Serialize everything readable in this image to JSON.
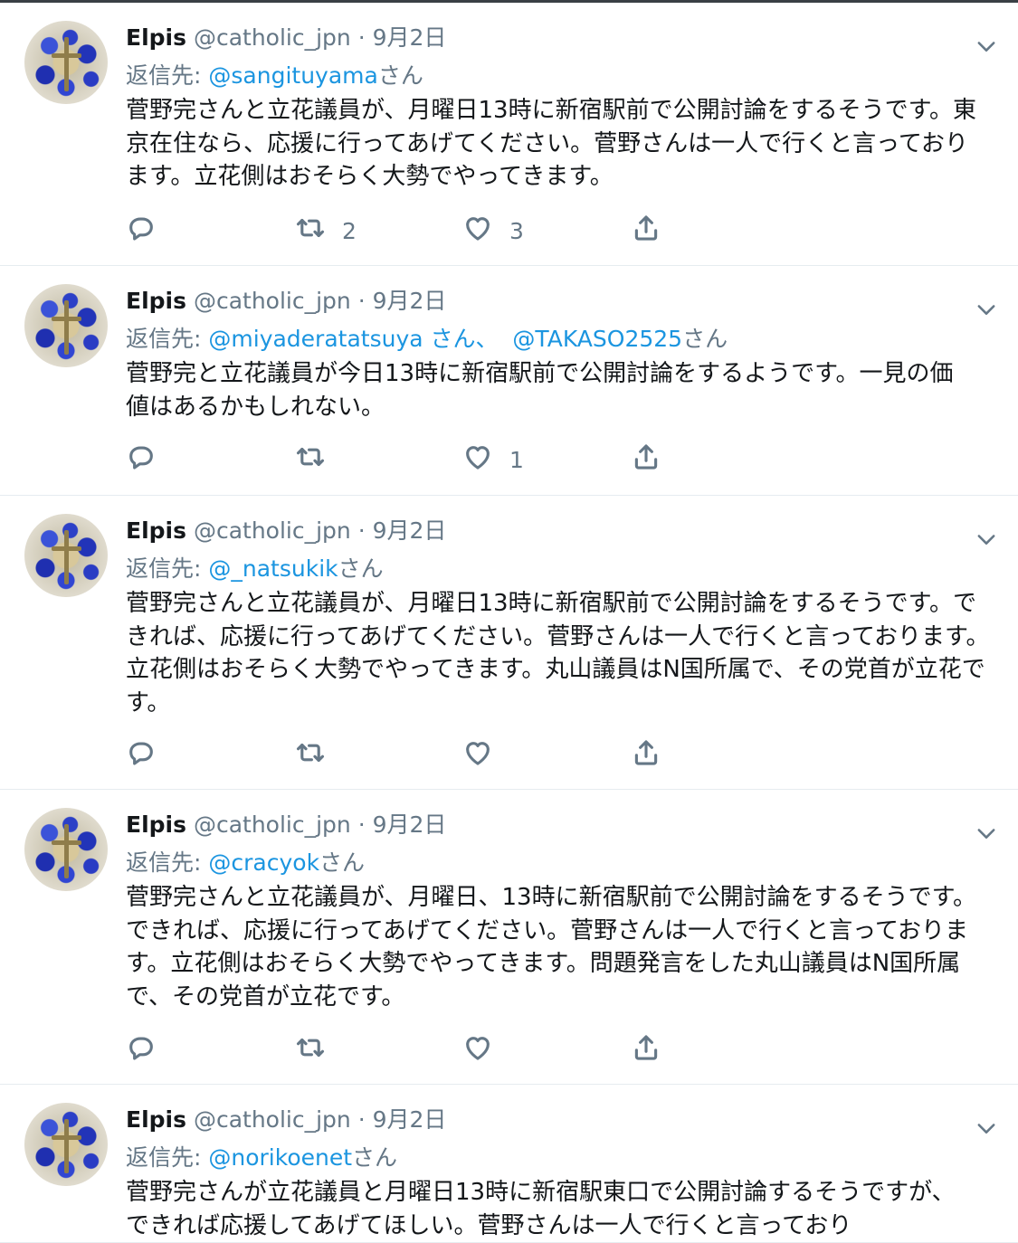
{
  "tweets": [
    {
      "name": "Elpis",
      "handle": "@catholic_jpn",
      "separator": "·",
      "date": "9月2日",
      "reply_label": "返信先:",
      "reply_to": [
        {
          "mention": "@sangituyama",
          "suffix": "さん"
        }
      ],
      "text": "菅野完さんと立花議員が、月曜日13時に新宿駅前で公開討論をするそうです。東京在住なら、応援に行ってあげてください。菅野さんは一人で行くと言っております。立花側はおそらく大勢でやってきます。",
      "retweets": "2",
      "likes": "3"
    },
    {
      "name": "Elpis",
      "handle": "@catholic_jpn",
      "separator": "·",
      "date": "9月2日",
      "reply_label": "返信先:",
      "reply_to": [
        {
          "mention": "@miyaderatatsuya さん、",
          "suffix": ""
        },
        {
          "mention": "@TAKASO2525",
          "suffix": "さん"
        }
      ],
      "text": "菅野完と立花議員が今日13時に新宿駅前で公開討論をするようです。一見の価値はあるかもしれない。",
      "retweets": "",
      "likes": "1"
    },
    {
      "name": "Elpis",
      "handle": "@catholic_jpn",
      "separator": "·",
      "date": "9月2日",
      "reply_label": "返信先:",
      "reply_to": [
        {
          "mention": "@_natsukik",
          "suffix": "さん"
        }
      ],
      "text": "菅野完さんと立花議員が、月曜日13時に新宿駅前で公開討論をするそうです。できれば、応援に行ってあげてください。菅野さんは一人で行くと言っております。立花側はおそらく大勢でやってきます。丸山議員はN国所属で、その党首が立花です。",
      "retweets": "",
      "likes": ""
    },
    {
      "name": "Elpis",
      "handle": "@catholic_jpn",
      "separator": "·",
      "date": "9月2日",
      "reply_label": "返信先:",
      "reply_to": [
        {
          "mention": "@cracyok",
          "suffix": "さん"
        }
      ],
      "text": "菅野完さんと立花議員が、月曜日、13時に新宿駅前で公開討論をするそうです。できれば、応援に行ってあげてください。菅野さんは一人で行くと言っております。立花側はおそらく大勢でやってきます。問題発言をした丸山議員はN国所属で、その党首が立花です。",
      "retweets": "",
      "likes": ""
    },
    {
      "name": "Elpis",
      "handle": "@catholic_jpn",
      "separator": "·",
      "date": "9月2日",
      "reply_label": "返信先:",
      "reply_to": [
        {
          "mention": "@norikoenet",
          "suffix": "さん"
        }
      ],
      "text": "菅野完さんが立花議員と月曜日13時に新宿駅東口で公開討論するそうですが、できれば応援してあげてほしい。菅野さんは一人で行くと言っており",
      "retweets": "",
      "likes": ""
    }
  ],
  "icons": {
    "reply": "reply-icon",
    "retweet": "retweet-icon",
    "like": "heart-icon",
    "share": "share-icon",
    "menu": "chevron-down-icon"
  }
}
